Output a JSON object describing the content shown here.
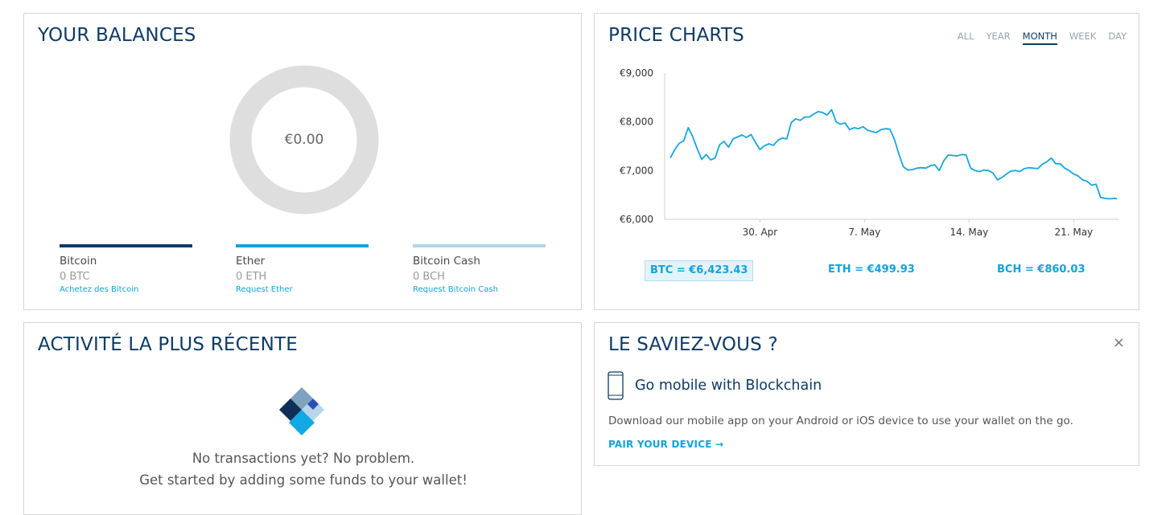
{
  "colors": {
    "title": "#0e3b66",
    "accent": "#10a3dd",
    "btc": "#0e3b66",
    "eth": "#10a3dd",
    "bch": "#b2d3e6",
    "donut": "#dedede",
    "line": "#17a7dd"
  },
  "balances": {
    "title": "YOUR BALANCES",
    "total": "€0.00",
    "coins": [
      {
        "name": "Bitcoin",
        "amount": "0 BTC",
        "link": "Achetez des Bitcoin"
      },
      {
        "name": "Ether",
        "amount": "0 ETH",
        "link": "Request Ether"
      },
      {
        "name": "Bitcoin Cash",
        "amount": "0 BCH",
        "link": "Request Bitcoin Cash"
      }
    ]
  },
  "prices": {
    "title": "PRICE CHARTS",
    "tabs": [
      "ALL",
      "YEAR",
      "MONTH",
      "WEEK",
      "DAY"
    ],
    "active_tab": "MONTH",
    "tickers": [
      {
        "label": "BTC = €6,423.43",
        "active": true
      },
      {
        "label": "ETH = €499.93",
        "active": false
      },
      {
        "label": "BCH = €860.03",
        "active": false
      }
    ]
  },
  "chart_data": {
    "type": "line",
    "title": "",
    "xlabel": "",
    "ylabel": "",
    "ylim": [
      6000,
      9000
    ],
    "yticks": [
      6000,
      7000,
      8000,
      9000
    ],
    "ytick_labels": [
      "€6,000",
      "€7,000",
      "€8,000",
      "€9,000"
    ],
    "xticks": [
      {
        "day": 6,
        "label": "30. Apr"
      },
      {
        "day": 13,
        "label": "7. May"
      },
      {
        "day": 20,
        "label": "14. May"
      },
      {
        "day": 27,
        "label": "21. May"
      }
    ],
    "x_unit": "days",
    "series": [
      {
        "name": "BTC",
        "x": [
          0.0,
          0.3,
          0.6,
          0.9,
          1.2,
          1.5,
          1.8,
          2.1,
          2.4,
          2.7,
          3.0,
          3.3,
          3.6,
          3.9,
          4.2,
          4.5,
          4.8,
          5.1,
          5.4,
          5.7,
          6.0,
          6.3,
          6.6,
          6.9,
          7.2,
          7.5,
          7.8,
          8.1,
          8.4,
          8.7,
          9.0,
          9.3,
          9.6,
          9.9,
          10.2,
          10.5,
          10.8,
          11.1,
          11.4,
          11.7,
          12.0,
          12.3,
          12.6,
          12.9,
          13.2,
          13.5,
          13.8,
          14.1,
          14.4,
          14.7,
          15.0,
          15.3,
          15.6,
          15.9,
          16.2,
          16.5,
          16.8,
          17.1,
          17.4,
          17.7,
          18.0,
          18.3,
          18.6,
          18.9,
          19.2,
          19.5,
          19.8,
          20.1,
          20.4,
          20.7,
          21.0,
          21.3,
          21.6,
          21.9,
          22.2,
          22.5,
          22.8,
          23.1,
          23.4,
          23.7,
          24.0,
          24.3,
          24.6,
          24.9,
          25.2,
          25.5,
          25.8,
          26.1,
          26.4,
          26.7,
          27.0,
          27.3,
          27.6,
          27.9,
          28.2,
          28.5,
          28.8,
          29.1,
          29.4,
          29.7,
          29.9
        ],
        "values": [
          7260,
          7430,
          7560,
          7610,
          7880,
          7700,
          7450,
          7230,
          7330,
          7220,
          7260,
          7530,
          7600,
          7480,
          7650,
          7690,
          7730,
          7680,
          7740,
          7580,
          7430,
          7510,
          7550,
          7520,
          7620,
          7670,
          7650,
          7990,
          8060,
          8030,
          8100,
          8100,
          8160,
          8210,
          8190,
          8140,
          8250,
          8000,
          7950,
          7980,
          7840,
          7880,
          7860,
          7900,
          7830,
          7800,
          7780,
          7840,
          7860,
          7850,
          7640,
          7340,
          7080,
          7010,
          7020,
          7050,
          7060,
          7050,
          7100,
          7120,
          7000,
          7200,
          7320,
          7310,
          7300,
          7330,
          7320,
          7050,
          7000,
          6980,
          7010,
          7000,
          6950,
          6810,
          6860,
          6930,
          6990,
          7000,
          6980,
          7040,
          7060,
          7050,
          7040,
          7130,
          7180,
          7260,
          7140,
          7140,
          7050,
          7000,
          6930,
          6890,
          6810,
          6780,
          6700,
          6720,
          6450,
          6430,
          6420,
          6430,
          6423
        ]
      }
    ],
    "grid": false
  },
  "activity": {
    "title": "ACTIVITÉ LA PLUS RÉCENTE",
    "empty_line1": "No transactions yet? No problem.",
    "empty_line2": "Get started by adding some funds to your wallet!"
  },
  "tip": {
    "title": "LE SAVIEZ-VOUS ?",
    "close": "×",
    "heading": "Go mobile with Blockchain",
    "body": "Download our mobile app on your Android or iOS device to use your wallet on the go.",
    "link": "PAIR YOUR DEVICE →"
  }
}
